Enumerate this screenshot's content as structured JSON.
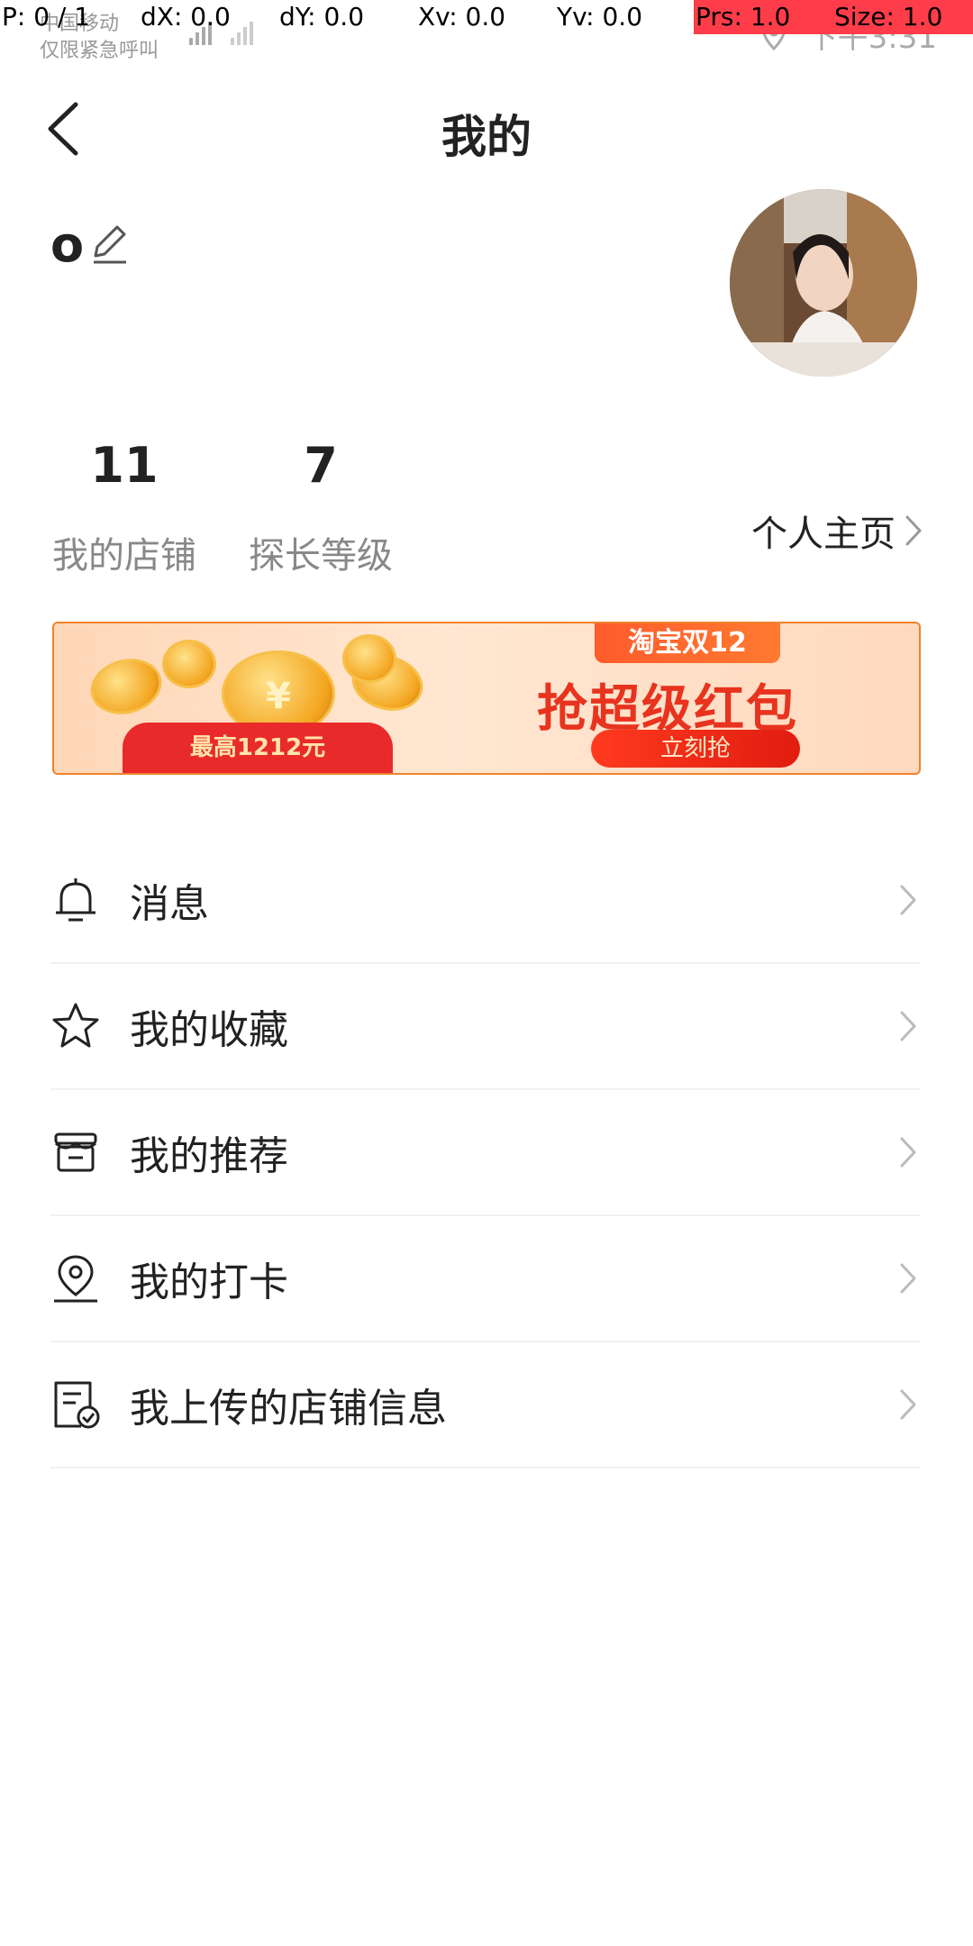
{
  "debug": {
    "p": "P: 0 / 1",
    "dx": "dX: 0.0",
    "dy": "dY: 0.0",
    "xv": "Xv: 0.0",
    "yv": "Yv: 0.0",
    "prs": "Prs: 1.0",
    "size": "Size: 1.0"
  },
  "status_bar": {
    "carrier": "中国移动",
    "emergency": "仅限紧急呼叫",
    "time": "下午3:31"
  },
  "header": {
    "title": "我的",
    "back_icon": "chevron-left-icon"
  },
  "profile": {
    "username": "o",
    "edit_icon": "pencil-icon"
  },
  "stats": [
    {
      "value": "11",
      "label": "我的店铺"
    },
    {
      "value": "7",
      "label": "探长等级"
    }
  ],
  "homepage_link": "个人主页",
  "banner": {
    "tag": "淘宝双12",
    "headline": "抢超级红包",
    "cta": "立刻抢",
    "max_amount": "最高1212元"
  },
  "menu": [
    {
      "label": "消息",
      "icon": "bell-icon"
    },
    {
      "label": "我的收藏",
      "icon": "star-icon"
    },
    {
      "label": "我的推荐",
      "icon": "store-icon"
    },
    {
      "label": "我的打卡",
      "icon": "location-pin-icon"
    },
    {
      "label": "我上传的店铺信息",
      "icon": "document-check-icon"
    }
  ],
  "colors": {
    "accent_red": "#e8331e",
    "divider": "#f0f0f0",
    "secondary_text": "#888888"
  }
}
